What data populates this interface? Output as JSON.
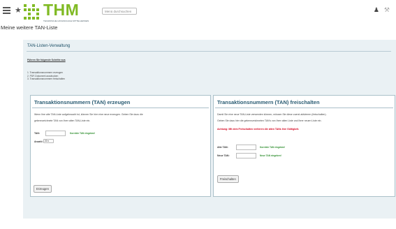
{
  "header": {
    "menu_icon": "hamburger-menu-icon",
    "star_icon": "star-icon",
    "logo_text": "THM",
    "logo_subtitle": "TECHNISCHE HOCHSCHULE MITTELHESSEN",
    "search_placeholder": "Menü durchsuchen",
    "user_icon": "user-icon",
    "tools_icon": "tools-icon",
    "brand_color": "#80ba24"
  },
  "page": {
    "title": "Meine weitere TAN-Liste"
  },
  "panel": {
    "heading": "TAN-Listen-Verwaltung",
    "steps_title": "Führen Sie folgende Schritte aus",
    "steps": [
      "1.  Transaktionsnummern erzeugen",
      "2.  PDF-Dokument ausdrucken",
      "3.  Transaktionsnummern freischalten"
    ]
  },
  "generate": {
    "title": "Transaktionsnummern (TAN) erzeugen",
    "desc_line1": "Wenn Ihre alte TAN-Liste aufgebraucht ist, können Sie hier eine neue erzeugen. Geben Sie dazu die",
    "desc_line2": "gekennzeichnete TAN von Ihrer alten TAN-Liste ein.",
    "tan_label": "TAN:",
    "tan_value": "",
    "tan_hint": "Korrekte TAN eingeben!",
    "count_label": "Anzahl:",
    "count_value": "20",
    "button_label": "Erzeugen"
  },
  "activate": {
    "title": "Transaktionsnummern (TAN) freischalten",
    "desc_line1": "Damit Sie eine neue TAN-Liste verwenden können, müssen Sie diese zuerst aktivieren (freischalten).",
    "desc_line2": "Geben Sie dazu hier die gekennzeichneten TAN's von Ihrer alten Liste und Ihrer neuen Liste ein.",
    "warning": "Achtung: Mit dem Freischalten verlieren die alten TANs ihre Gültigkeit.",
    "old_tan_label": "Alte TAN:",
    "old_tan_value": "",
    "old_tan_hint": "Korrekte TAN eingeben!",
    "new_tan_label": "Neue TAN:",
    "new_tan_value": "",
    "new_tan_hint": "Neue TAN eingeben!",
    "button_label": "Freischalten"
  }
}
